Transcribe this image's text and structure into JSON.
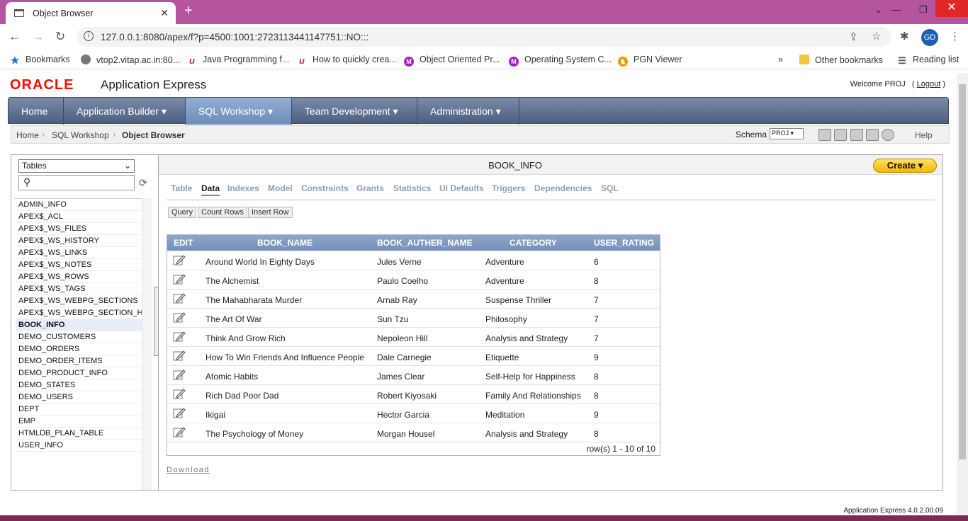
{
  "browser": {
    "tab_title": "Object Browser",
    "new_tab": "+",
    "url": "127.0.0.1:8080/apex/f?p=4500:1001:2723113441147751::NO:::",
    "profile_initials": "GD",
    "bookmarks": [
      {
        "label": "Bookmarks",
        "icon": "star-icon"
      },
      {
        "label": "vtop2.vitap.ac.in:80...",
        "icon": "site-icon"
      },
      {
        "label": "Java Programming f...",
        "icon": "u-icon"
      },
      {
        "label": "How to quickly crea...",
        "icon": "u-icon"
      },
      {
        "label": "Object Oriented Pr...",
        "icon": "m-icon"
      },
      {
        "label": "Operating System C...",
        "icon": "m-icon"
      },
      {
        "label": "PGN Viewer",
        "icon": "chess-icon"
      }
    ],
    "more_bookmarks": "»",
    "other_bookmarks": "Other bookmarks",
    "reading_list": "Reading list"
  },
  "apex": {
    "logo_oracle": "ORACLE",
    "logo_product": "Application Express",
    "welcome": "Welcome PROJ",
    "logout": "Logout",
    "menu": [
      {
        "label": "Home",
        "active": false
      },
      {
        "label": "Application Builder ▾",
        "active": false
      },
      {
        "label": "SQL Workshop ▾",
        "active": true
      },
      {
        "label": "Team Development ▾",
        "active": false
      },
      {
        "label": "Administration ▾",
        "active": false
      }
    ],
    "breadcrumbs": [
      "Home",
      "SQL Workshop",
      "Object Browser"
    ],
    "schema_label": "Schema",
    "schema_value": "PROJ ▾",
    "help": "Help",
    "object_type": "Tables",
    "objects": [
      "ADMIN_INFO",
      "APEX$_ACL",
      "APEX$_WS_FILES",
      "APEX$_WS_HISTORY",
      "APEX$_WS_LINKS",
      "APEX$_WS_NOTES",
      "APEX$_WS_ROWS",
      "APEX$_WS_TAGS",
      "APEX$_WS_WEBPG_SECTIONS",
      "APEX$_WS_WEBPG_SECTION_HISTORY",
      "BOOK_INFO",
      "DEMO_CUSTOMERS",
      "DEMO_ORDERS",
      "DEMO_ORDER_ITEMS",
      "DEMO_PRODUCT_INFO",
      "DEMO_STATES",
      "DEMO_USERS",
      "DEPT",
      "EMP",
      "HTMLDB_PLAN_TABLE",
      "USER_INFO"
    ],
    "selected_object": "BOOK_INFO",
    "panel_title": "BOOK_INFO",
    "create_label": "Create ▾",
    "subtabs": [
      "Table",
      "Data",
      "Indexes",
      "Model",
      "Constraints",
      "Grants",
      "Statistics",
      "UI Defaults",
      "Triggers",
      "Dependencies",
      "SQL"
    ],
    "active_subtab": "Data",
    "buttons": {
      "query": "Query",
      "count_rows": "Count Rows",
      "insert_row": "Insert Row"
    },
    "columns": [
      "EDIT",
      "BOOK_NAME",
      "BOOK_AUTHER_NAME",
      "CATEGORY",
      "USER_RATING"
    ],
    "rows": [
      [
        "Around World In Eighty Days",
        "Jules Verne",
        "Adventure",
        "6"
      ],
      [
        "The Alchemist",
        "Paulo Coelho",
        "Adventure",
        "8"
      ],
      [
        "The Mahabharata Murder",
        "Arnab Ray",
        "Suspense Thriller",
        "7"
      ],
      [
        "The Art Of War",
        "Sun Tzu",
        "Philosophy",
        "7"
      ],
      [
        "Think And Grow Rich",
        "Nepoleon Hill",
        "Analysis and Strategy",
        "7"
      ],
      [
        "How To Win Friends And Influence People",
        "Dale Carnegie",
        "Etiquette",
        "9"
      ],
      [
        "Atomic Habits",
        "James Clear",
        "Self-Help for Happiness",
        "8"
      ],
      [
        "Rich Dad Poor Dad",
        "Robert Kiyosaki",
        "Family And Relationships",
        "8"
      ],
      [
        "Ikigai",
        "Hector Garcia",
        "Meditation",
        "9"
      ],
      [
        "The Psychology of Money",
        "Morgan Housel",
        "Analysis and Strategy",
        "8"
      ]
    ],
    "row_summary": "row(s) 1 - 10 of 10",
    "download": "Download",
    "version": "Application Express 4.0.2.00.09"
  }
}
